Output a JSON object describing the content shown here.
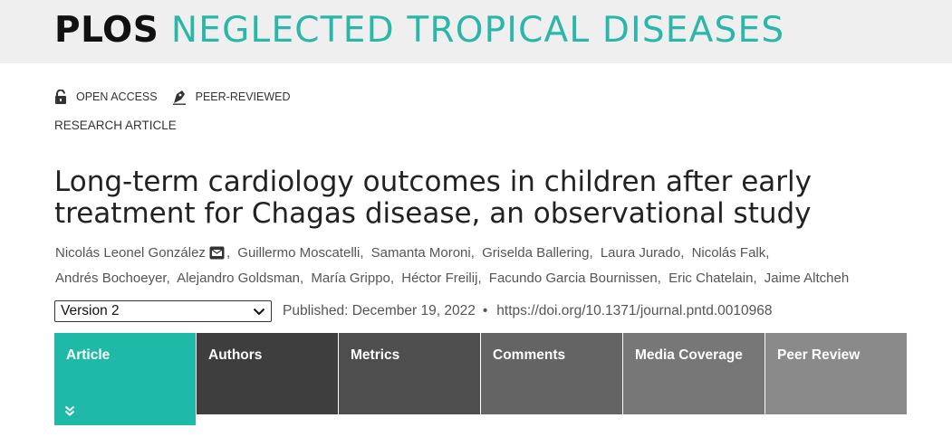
{
  "header": {
    "brand": "PLOS",
    "journal": "NEGLECTED TROPICAL DISEASES"
  },
  "badges": [
    {
      "label": "OPEN ACCESS",
      "icon": "lock-open-icon"
    },
    {
      "label": "PEER-REVIEWED",
      "icon": "pen-nib-icon"
    }
  ],
  "article_type": "RESEARCH ARTICLE",
  "title": "Long-term cardiology outcomes in children after early treatment for Chagas disease, an observational study",
  "authors": {
    "line1": [
      "Nicolás Leonel González",
      "Guillermo Moscatelli",
      "Samanta Moroni",
      "Griselda Ballering",
      "Laura Jurado",
      "Nicolás Falk,"
    ],
    "line2": [
      "Andrés Bochoeyer",
      "Alejandro Goldsman",
      "María Grippo",
      "Héctor Freilij",
      "Facundo Garcia Bournissen",
      "Eric Chatelain",
      "Jaime Altcheh"
    ]
  },
  "meta": {
    "version_selected": "Version 2",
    "published": "Published: December 19, 2022",
    "separator": "•",
    "doi": "https://doi.org/10.1371/journal.pntd.0010968"
  },
  "tabs": [
    {
      "label": "Article",
      "active": true,
      "color": "#1fbaa7"
    },
    {
      "label": "Authors",
      "active": false,
      "color": "#3e3e3e"
    },
    {
      "label": "Metrics",
      "active": false,
      "color": "#4e4e4e"
    },
    {
      "label": "Comments",
      "active": false,
      "color": "#646464"
    },
    {
      "label": "Media Coverage",
      "active": false,
      "color": "#777777"
    },
    {
      "label": "Peer Review",
      "active": false,
      "color": "#8a8a8a"
    }
  ],
  "colors": {
    "banner_bg": "#efefef",
    "accent": "#2ab7a9",
    "active_tab": "#1fbaa7"
  }
}
